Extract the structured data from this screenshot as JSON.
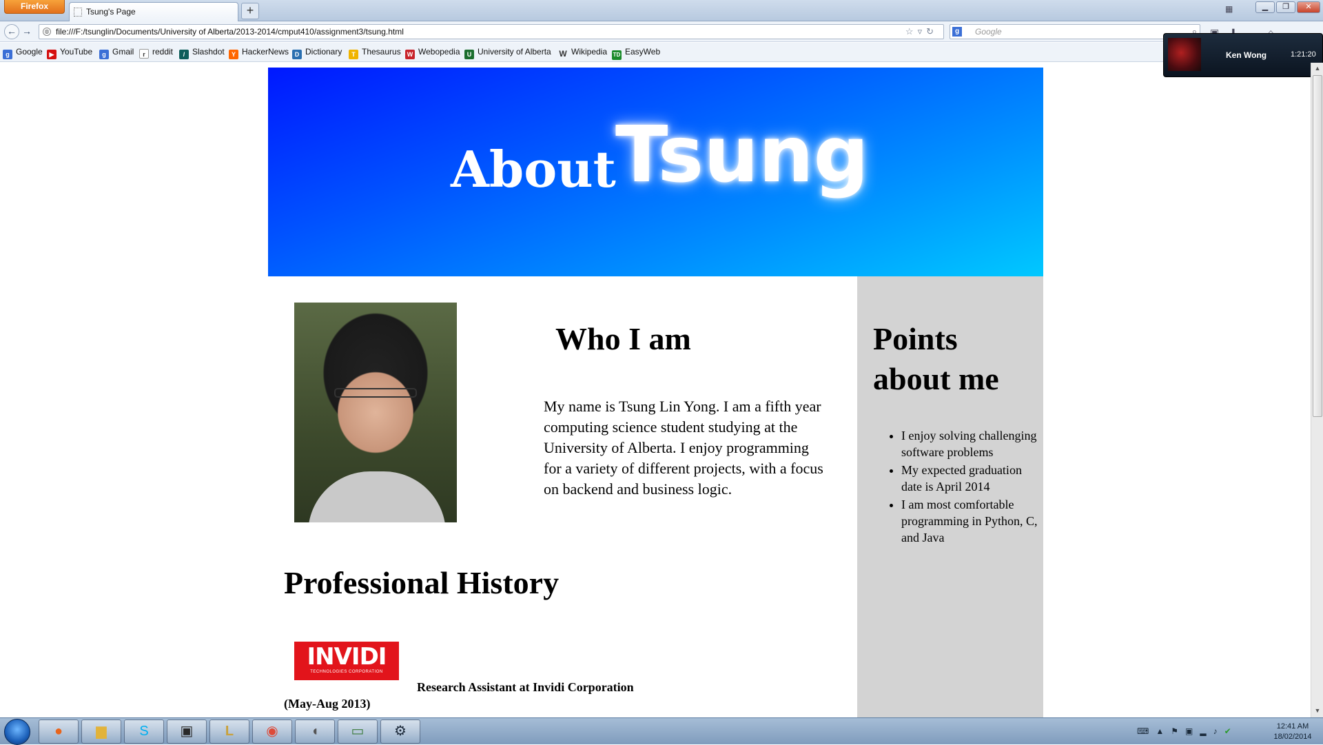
{
  "browser": {
    "app_button": "Firefox",
    "tab_title": "Tsung's Page",
    "new_tab": "+",
    "url": "file:///F:/tsunglin/Documents/University of Alberta/2013-2014/cmput410/assignment3/tsung.html",
    "search_placeholder": "Google"
  },
  "bookmarks": [
    {
      "label": "Google",
      "icon": "google-icon",
      "color": "#3b6fd6",
      "glyph": "g"
    },
    {
      "label": "YouTube",
      "icon": "youtube-icon",
      "color": "#d51010",
      "glyph": "▶"
    },
    {
      "label": "Gmail",
      "icon": "gmail-icon",
      "color": "#3b6fd6",
      "glyph": "g"
    },
    {
      "label": "reddit",
      "icon": "reddit-icon",
      "color": "#ff4500",
      "glyph": "r"
    },
    {
      "label": "Slashdot",
      "icon": "slashdot-icon",
      "color": "#0e5e5a",
      "glyph": "/"
    },
    {
      "label": "HackerNews",
      "icon": "hackernews-icon",
      "color": "#ff6600",
      "glyph": "Y"
    },
    {
      "label": "Dictionary",
      "icon": "dictionary-icon",
      "color": "#2a6fb0",
      "glyph": "D"
    },
    {
      "label": "Thesaurus",
      "icon": "thesaurus-icon",
      "color": "#f0b400",
      "glyph": "T"
    },
    {
      "label": "Webopedia",
      "icon": "webopedia-icon",
      "color": "#c8232a",
      "glyph": "W"
    },
    {
      "label": "University of Alberta",
      "icon": "ualberta-icon",
      "color": "#1b6e2e",
      "glyph": "U"
    },
    {
      "label": "Wikipedia",
      "icon": "wikipedia-icon",
      "color": "#555555",
      "glyph": "W"
    },
    {
      "label": "EasyWeb",
      "icon": "easyweb-icon",
      "color": "#1a8a2a",
      "glyph": "TD"
    }
  ],
  "skype_call": {
    "name": "Ken Wong",
    "duration": "1:21:20"
  },
  "page": {
    "banner": {
      "about": "About",
      "name": "Tsung"
    },
    "who_heading": "Who I am",
    "bio": "My name is Tsung Lin Yong. I am a fifth year computing science student studying at the University of Alberta. I enjoy programming for a variety of different projects, with a focus on backend and business logic.",
    "professional_heading": "Professional History",
    "company_logo": {
      "text": "INVIDI",
      "subtext": "TECHNOLOGIES CORPORATION",
      "color": "#e2141b"
    },
    "role": "Research Assistant at Invidi Corporation",
    "dates": "(May-Aug 2013)",
    "sidebar": {
      "heading": "Points about me",
      "points": [
        "I enjoy solving challenging software problems",
        "My expected graduation date is April 2014",
        "I am most comfortable programming in Python, C, and Java"
      ]
    }
  },
  "taskbar": {
    "apps": [
      "firefox-icon",
      "explorer-icon",
      "skype-icon",
      "terminal-icon",
      "league-icon",
      "chrome-icon",
      "mouse-icon",
      "monitor-icon",
      "steam-icon"
    ],
    "clock_time": "12:41 AM",
    "clock_date": "18/02/2014"
  },
  "colors": {
    "banner_start": "#0018ff",
    "banner_end": "#00c8ff",
    "sidebar_bg": "#d3d3d3"
  }
}
